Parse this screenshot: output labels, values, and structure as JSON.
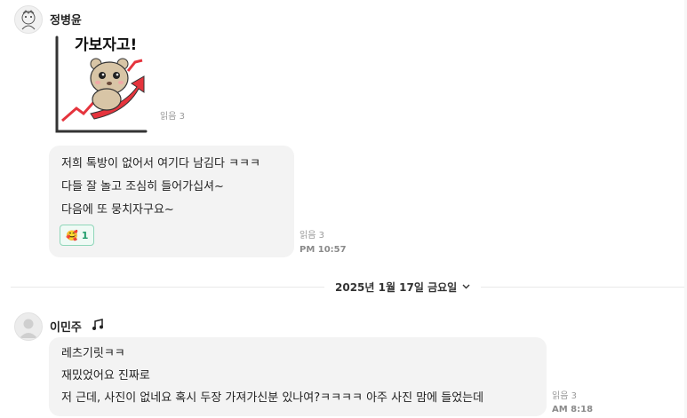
{
  "messages": [
    {
      "sender": "정병윤",
      "sticker_text": "가보자고!",
      "sticker_read": "읽음 3"
    },
    {
      "lines": [
        "저희 톡방이 없어서 여기다 남김다 ㅋㅋㅋ",
        "다들 잘 놀고 조심히 들어가십셔~",
        "다음에 또 뭉치자구요~"
      ],
      "reaction": {
        "emoji": "🥰",
        "count": "1"
      },
      "read": "읽음 3",
      "time": "PM 10:57"
    }
  ],
  "date_divider": {
    "label": "2025년 1월 17일 금요일",
    "icon": "chevron-down-icon"
  },
  "second": {
    "sender": "이민주",
    "badge_icon": "music-note-icon",
    "lines": [
      "레츠기릿ㅋㅋ",
      "재밌었어요 진짜로",
      "저 근데, 사진이 없네요 혹시 두장 가져가신분 있나여?ㅋㅋㅋㅋ 아주 사진 맘에 들었는데"
    ],
    "read": "읽음 3",
    "time": "AM 8:18"
  },
  "colors": {
    "arrow": "#e5343d",
    "bear": "#d8c5a6",
    "reaction_border": "#8fd6b9",
    "reaction_text": "#1f9d6b"
  }
}
